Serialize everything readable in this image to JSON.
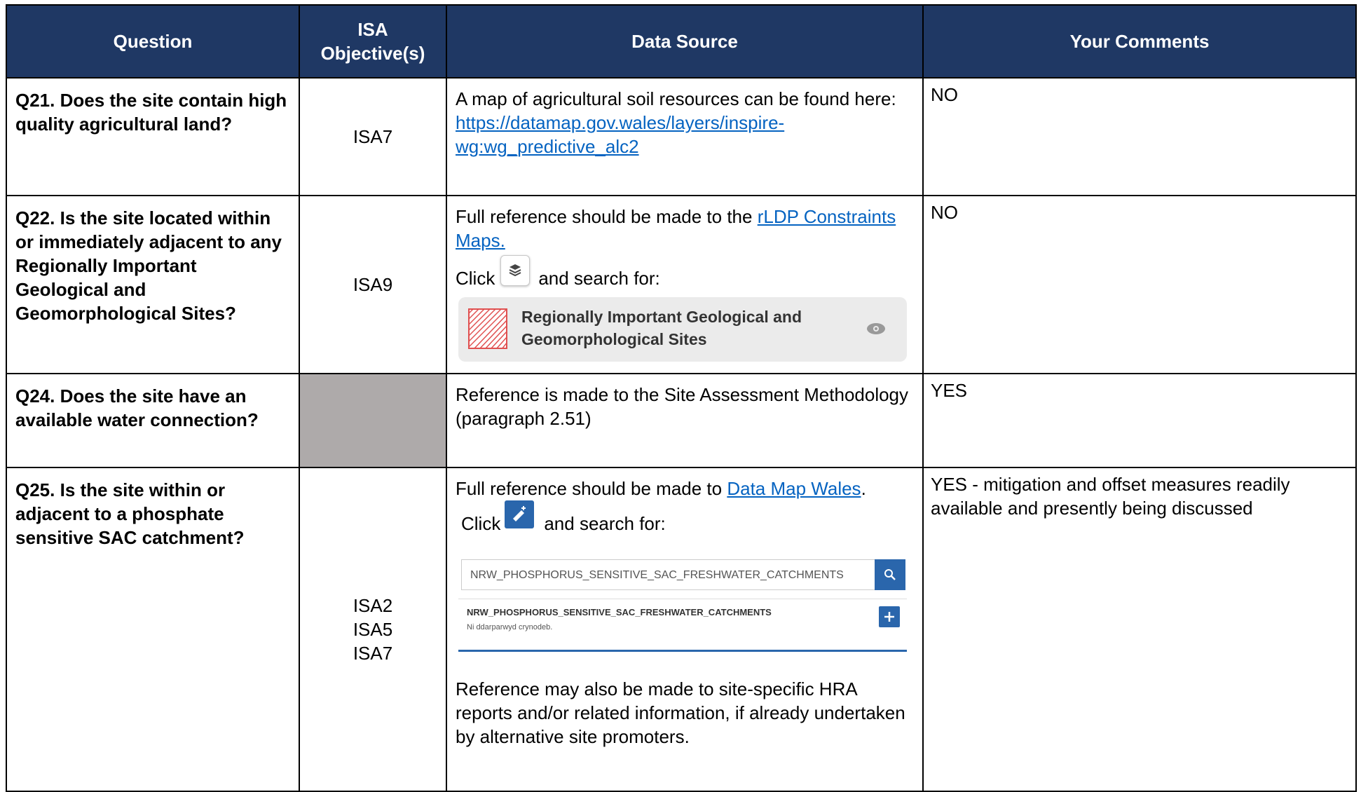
{
  "header": {
    "question": "Question",
    "isa": "ISA Objective(s)",
    "source": "Data Source",
    "comments": "Your Comments"
  },
  "rows": [
    {
      "question": "Q21. Does the site contain high quality agricultural land?",
      "isa": "ISA7",
      "source_text": "A map of agricultural soil resources can be found here:",
      "source_link": "https://datamap.gov.wales/layers/inspire-wg:wg_predictive_alc2",
      "comment": "NO"
    },
    {
      "question": "Q22. Is the site located within or immediately adjacent to any Regionally Important Geological and Geomorphological Sites?",
      "isa": "ISA9",
      "source_text": "Full reference should be made to the ",
      "source_link": "rLDP Constraints Maps.",
      "click_label": "Click",
      "search_label": "and search for:",
      "layer_name": "Regionally Important Geological and Geomorphological Sites",
      "layer_icon": "layers-icon",
      "comment": "NO"
    },
    {
      "question": "Q24. Does the site have an available water connection?",
      "isa": "",
      "source_text": "Reference is made to the Site Assessment Methodology (paragraph 2.51)",
      "comment": "YES"
    },
    {
      "question": "Q25. Is the site within or adjacent to a phosphate sensitive SAC catchment?",
      "isa_lines": [
        "ISA2",
        "ISA5",
        "ISA7"
      ],
      "source_text": "Full reference should be made to ",
      "source_link": "Data Map Wales",
      "source_text_end": ".",
      "click_label": "Click",
      "search_label": "and search for:",
      "search_value": "NRW_PHOSPHORUS_SENSITIVE_SAC_FRESHWATER_CATCHMENTS",
      "result_title": "NRW_PHOSPHORUS_SENSITIVE_SAC_FRESHWATER_CATCHMENTS",
      "result_sub": "Ni ddarparwyd crynodeb.",
      "source_text_2": "Reference may also be made to site-specific HRA reports and/or related information, if already undertaken by alternative site promoters.",
      "comment": "YES - mitigation and offset measures readily available and presently being discussed"
    }
  ],
  "colors": {
    "header_bg": "#1f3864",
    "gray_cell": "#aeaaaa",
    "link": "#0563c1",
    "accent_blue": "#2a66ac"
  }
}
